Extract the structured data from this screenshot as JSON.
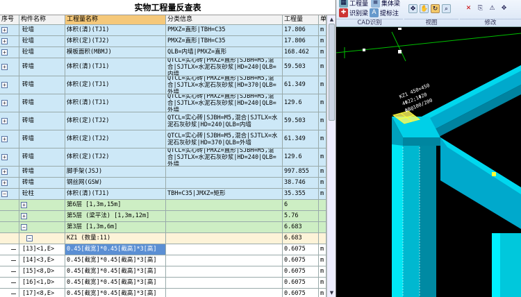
{
  "report": {
    "title": "实物工程量反查表",
    "headers": [
      "序号",
      "构件名称",
      "工程量名称",
      "分类信息",
      "工程量",
      "单"
    ]
  },
  "rows": [
    {
      "kind": "blue",
      "pm": "+",
      "member": "砼墙",
      "qname": "体积(清)(TJ1)",
      "cat": "PMXZ=直形|TBH=C35",
      "qty": "17.806",
      "unit": "m"
    },
    {
      "kind": "blue",
      "pm": "+",
      "member": "砼墙",
      "qname": "体积(定)(TJ2)",
      "cat": "PMXZ=直形|TBH=C35",
      "qty": "17.806",
      "unit": "m"
    },
    {
      "kind": "blue",
      "pm": "+",
      "member": "砼墙",
      "qname": "模板面积(MBMJ)",
      "cat": "QLB=内墙|PMXZ=直形",
      "qty": "168.462",
      "unit": "m"
    },
    {
      "kind": "blue2",
      "pm": "+",
      "member": "砖墙",
      "qname": "体积(清)(TJ1)",
      "cat": "QTCL=实心砖|PMXZ=直形|SJBH=M5,混合|SJTLX=水泥石灰砂浆|HD=240|QLB=内墙",
      "qty": "59.503",
      "unit": "m"
    },
    {
      "kind": "blue2",
      "pm": "+",
      "member": "砖墙",
      "qname": "体积(定)(TJ1)",
      "cat": "QTCL=实心砖|PMXZ=直形|SJBH=M5,混合|SJTLX=水泥石灰砂浆|HD=370|QLB=外墙",
      "qty": "61.349",
      "unit": "m"
    },
    {
      "kind": "blue2",
      "pm": "+",
      "member": "砖墙",
      "qname": "体积(清)(TJ1)",
      "cat": "QTCL=实心砖|PMXZ=直形|SJBH=M5,混合|SJTLX=水泥石灰砂浆|HD=240|QLB=外墙",
      "qty": "129.6",
      "unit": "m"
    },
    {
      "kind": "blue2",
      "pm": "+",
      "member": "砖墙",
      "qname": "体积(定)(TJ2)",
      "cat": "QTCL=实心砖|SJBH=M5,混合|SJTLX=水泥石灰砂浆|HD=240|QLB=内墙",
      "qty": "59.503",
      "unit": "m"
    },
    {
      "kind": "blue2",
      "pm": "+",
      "member": "砖墙",
      "qname": "体积(定)(TJ2)",
      "cat": "QTCL=实心砖|SJBH=M5,混合|SJTLX=水泥石灰砂浆|HD=370|QLB=外墙",
      "qty": "61.349",
      "unit": "m"
    },
    {
      "kind": "blue2",
      "pm": "+",
      "member": "砖墙",
      "qname": "体积(定)(TJ2)",
      "cat": "QTCL=实心砖|PMXZ=直形|SJBH=M5,混合|SJTLX=水泥石灰砂浆|HD=240|QLB=外墙",
      "qty": "129.6",
      "unit": "m"
    },
    {
      "kind": "blue",
      "pm": "+",
      "member": "砖墙",
      "qname": "脚手架(JSJ)",
      "cat": "",
      "qty": "997.855",
      "unit": "m"
    },
    {
      "kind": "blue",
      "pm": "+",
      "member": "砖墙",
      "qname": "钢丝网(GSW)",
      "cat": "",
      "qty": "38.746",
      "unit": "m"
    },
    {
      "kind": "blue",
      "pm": "-",
      "member": "砼柱",
      "qname": "体积(清)(TJ1)",
      "cat": "TBH=C35|JMXZ=矩形",
      "qty": "35.355",
      "unit": "m"
    },
    {
      "kind": "green",
      "pm": "+",
      "member": "",
      "qname": "第6层 [1,3m,15m]",
      "cat": "",
      "qty": "6",
      "unit": ""
    },
    {
      "kind": "green",
      "pm": "+",
      "member": "",
      "qname": "第5层 (梁平法) [1,3m,12m]",
      "cat": "",
      "qty": "5.76",
      "unit": ""
    },
    {
      "kind": "green",
      "pm": "-",
      "member": "",
      "qname": "第3层 [1,3m,6m]",
      "cat": "",
      "qty": "6.683",
      "unit": ""
    },
    {
      "kind": "cream",
      "pm": "-",
      "member": "",
      "qname": "KZ1 (数量:11)",
      "cat": "",
      "qty": "6.683",
      "unit": ""
    },
    {
      "kind": "white",
      "pm": "",
      "member": "[13]<1,E>",
      "qname": "0.45[截宽]*0.45[截高]*3[高]",
      "cat": "",
      "qty": "0.6075",
      "unit": "m",
      "sel": true
    },
    {
      "kind": "white",
      "pm": "",
      "member": "[14]<3,E>",
      "qname": "0.45[截宽]*0.45[截高]*3[高]",
      "cat": "",
      "qty": "0.6075",
      "unit": "m"
    },
    {
      "kind": "white",
      "pm": "",
      "member": "[15]<8,D>",
      "qname": "0.45[截宽]*0.45[截高]*3[高]",
      "cat": "",
      "qty": "0.6075",
      "unit": "m"
    },
    {
      "kind": "white",
      "pm": "",
      "member": "[16]<1,D>",
      "qname": "0.45[截宽]*0.45[截高]*3[高]",
      "cat": "",
      "qty": "0.6075",
      "unit": "m"
    },
    {
      "kind": "white",
      "pm": "",
      "member": "[17]<8,E>",
      "qname": "0.45[截宽]*0.45[截高]*3[高]",
      "cat": "",
      "qty": "0.6075",
      "unit": "m"
    }
  ],
  "toolbar": {
    "btn_project": "工程量",
    "btn_beam": "集体梁",
    "btn_identify_beam": "识别梁",
    "btn_extract_label": "提标注",
    "grp_cad": "CAD识别",
    "grp_view": "视图",
    "grp_modify": "修改"
  },
  "viewport": {
    "label_line1": "KZ1 450×450",
    "label_line2": "4Φ22;1Φ20",
    "label_line3": "Φ8@100/200"
  },
  "colors": {
    "beam": "#00b8d8",
    "column_front": "#00e0f0",
    "column_side": "#008fa8",
    "highlight": "#ffff33",
    "grid_line": "#00c000",
    "label": "#0a9"
  }
}
